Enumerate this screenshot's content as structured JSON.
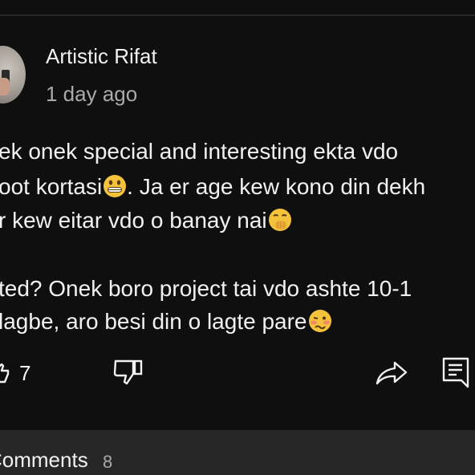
{
  "comment": {
    "author": "Artistic Rifat",
    "timestamp": "1 day ago",
    "lines": [
      "ek onek special and interesting ekta vdo",
      "oot kortasi",
      ". Ja er age kew kono din dekh",
      " r kew eitar vdo o banay nai",
      "ted?  Onek boro project tai vdo ashte 10-1",
      " lagbe, aro besi din o lagte pare"
    ],
    "emojis": [
      "grinning-face",
      "face-with-hand-over-mouth",
      "woozy-face"
    ]
  },
  "actions": {
    "like_count": "7",
    "icons": [
      "like-icon",
      "dislike-icon",
      "share-icon",
      "reply-icon"
    ]
  },
  "footer": {
    "comments_label": "Comments",
    "comments_count": "8"
  },
  "colors": {
    "background": "#0f0f0f",
    "footer_bg": "#272727",
    "text_primary": "#f1f1f1",
    "text_secondary": "#aaaaaa",
    "emoji_yellow": "#f5c33b"
  }
}
